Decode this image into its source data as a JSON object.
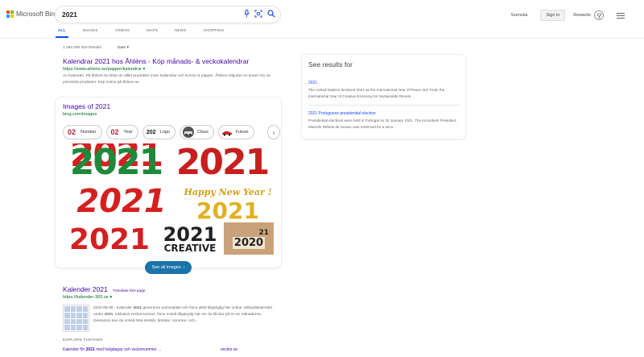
{
  "header": {
    "logo_text": "Microsoft Bing",
    "search_value": "2021",
    "tabs": [
      {
        "label": "ALL",
        "active": true
      },
      {
        "label": "IMAGES",
        "active": false
      },
      {
        "label": "VIDEOS",
        "active": false
      },
      {
        "label": "MAPS",
        "active": false
      },
      {
        "label": "NEWS",
        "active": false
      },
      {
        "label": "SHOPPING",
        "active": false
      }
    ],
    "language": "Svenska",
    "sign_in": "Sign in",
    "rewards": "Rewards"
  },
  "results_info": {
    "count": "1 260 000 000 Results",
    "date_filter": "Date"
  },
  "result1": {
    "title": "Kalendrar 2021 hos Åhléns - Köp månads- & veckokalendrar",
    "url": "https://www.ahlens.se/papper/kalendrar",
    "snippet": "Av Kalender, På åhlens.se hittar du alltid produkter inom Kalendrar och Kontor & papper. Åhléns erbjuder en smart mix av prisvärda produkter. Köp online på åhlens.se"
  },
  "images_card": {
    "title": "Images of 2021",
    "url": "bing.com/images",
    "chips": [
      {
        "thumb": "02",
        "label": "Number"
      },
      {
        "thumb": "02",
        "label": "Year"
      },
      {
        "thumb": "202",
        "label": "Logo"
      },
      {
        "thumb": "",
        "label": "Class"
      },
      {
        "thumb": "",
        "label": "Future"
      }
    ],
    "tiles": [
      {
        "text": "2021",
        "bg": "#ffffff",
        "fg": "#1d8a3a"
      },
      {
        "text": "2021",
        "bg": "#ffffff",
        "fg": "#c81e1e"
      },
      {
        "text": "2021",
        "bg": "#ffffff",
        "fg": "#d42020"
      },
      {
        "text": "Happy New Year !",
        "bg": "#ffffff",
        "fg": "#d4a017"
      },
      {
        "text": "2021",
        "bg": "#ffffff",
        "fg": "#e0b020"
      },
      {
        "text": "2021",
        "bg": "#ffffff",
        "fg": "#d42020"
      },
      {
        "text": "2021",
        "bg": "#ffffff",
        "fg": "#222222"
      },
      {
        "text": "CREATIVE",
        "bg": "#ffffff",
        "fg": "#222222"
      },
      {
        "text": "2020",
        "bg": "#c9a27a",
        "fg": "#222222"
      },
      {
        "text": "21",
        "bg": "#c9a27a",
        "fg": "#222222"
      }
    ],
    "see_all": "See all images"
  },
  "side_panel": {
    "title": "See results for",
    "items": [
      {
        "title": "2021",
        "desc": "The United Nations declared 2021 as the International Year of Peace and Trust, the International Year of Creative Economy for Sustainable Develo..."
      },
      {
        "title": "2021 Portuguese presidential election",
        "desc": "Presidential elections were held in Portugal on 24 January 2021. The incumbent President, Marcelo Rebelo de Sousa, was reelected for a seco..."
      }
    ]
  },
  "result2": {
    "title": "Kalender 2021",
    "translate": "Translate this page",
    "url": "https://kalender-365.se",
    "snippet_date": "2020-06-08 · Kalender",
    "snippet_bold1": "2021",
    "snippet_mid": " genereras automatiskt och finns alltid tillgänglig här online. Månadskalender under ",
    "snippet_bold2": "2021",
    "snippet_tail": ", inklusive veckonummer, finns också tillgänglig när om du klickar på en av månaderna. Dessutom kan du också hitta skottår, årstider, sommar- och..."
  },
  "explore": {
    "heading": "EXPLORE FURTHER",
    "link1_pre": "Kalender för ",
    "link1_bold": "2021",
    "link1_post": " med helgdagar och veckonummer ...",
    "link2": "veckor.se"
  }
}
